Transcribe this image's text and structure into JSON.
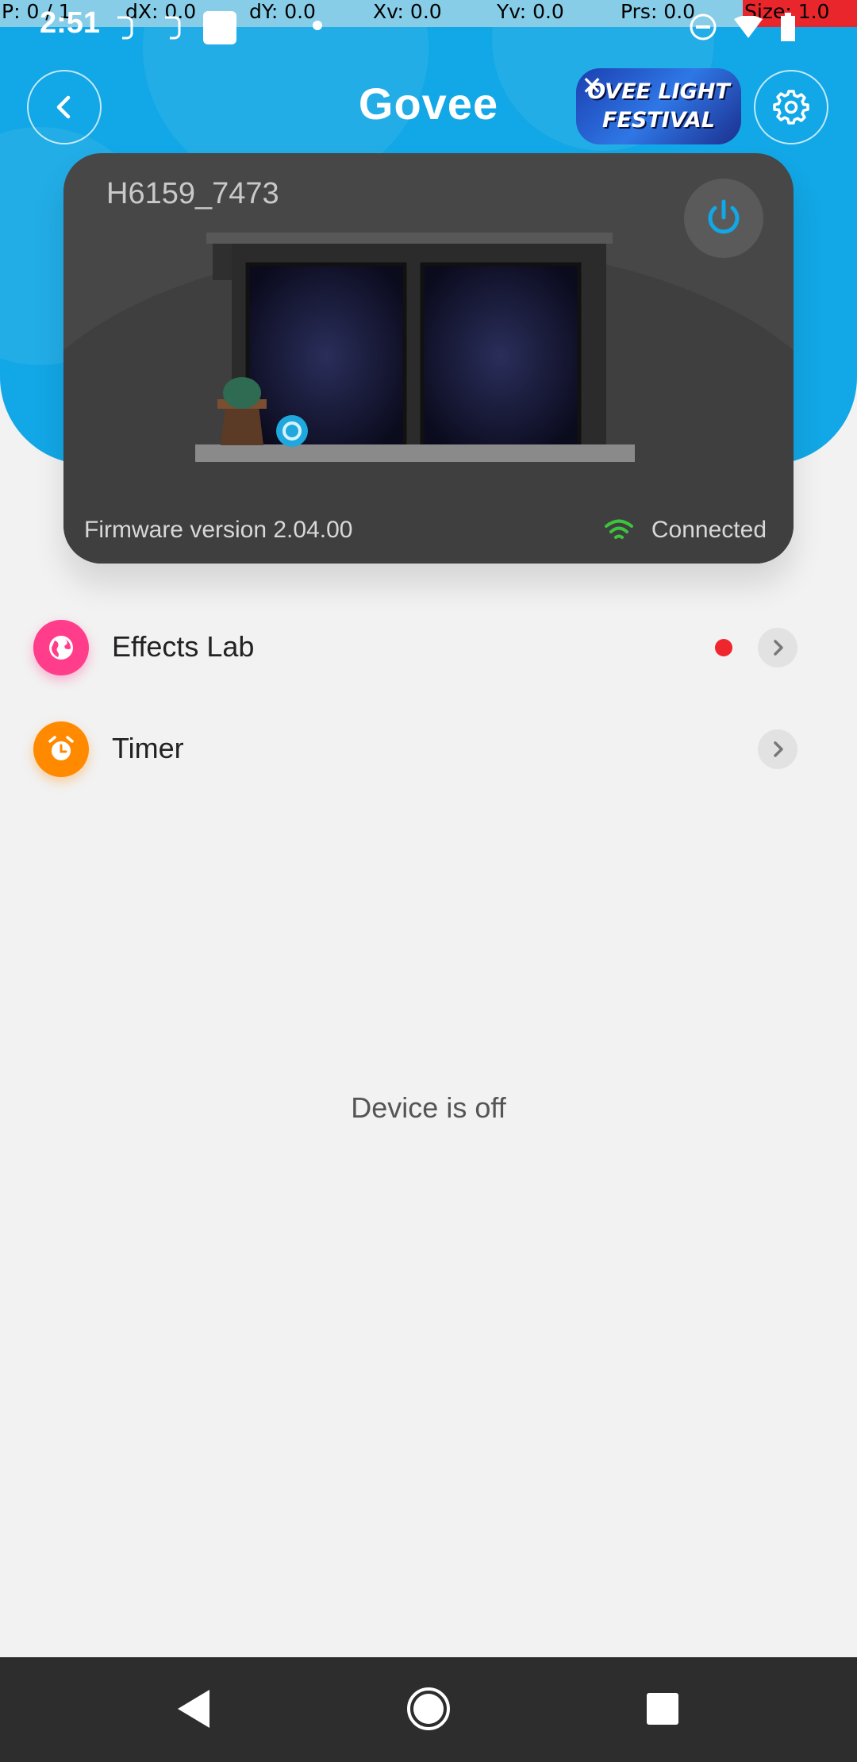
{
  "debug": {
    "pointer": "P: 0 / 1",
    "dx": "dX: 0.0",
    "dy": "dY: 0.0",
    "xv": "Xv: 0.0",
    "yv": "Yv: 0.0",
    "prs": "Prs: 0.0",
    "size": "Size: 1.0"
  },
  "status_bar": {
    "time": "2:51"
  },
  "header": {
    "logo": "Govee",
    "promo_line1": "OVEE LIGHT",
    "promo_line2": "FESTIVAL",
    "promo_close": "✕"
  },
  "device": {
    "name": "H6159_7473",
    "firmware": "Firmware version 2.04.00",
    "connection": "Connected"
  },
  "menu": [
    {
      "label": "Effects Lab",
      "icon": "globe-icon",
      "color": "#ff3d8b",
      "has_badge": true
    },
    {
      "label": "Timer",
      "icon": "alarm-clock-icon",
      "color": "#ff8a00",
      "has_badge": false
    }
  ],
  "status_message": "Device is off",
  "colors": {
    "accent": "#12a7e6",
    "card": "#474747",
    "badge": "#f0262e",
    "connected": "#3cc43c"
  }
}
